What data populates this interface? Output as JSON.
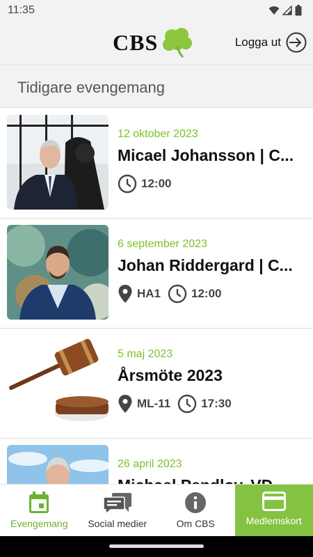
{
  "status_bar": {
    "time": "11:35"
  },
  "header": {
    "logo_text": "CBS",
    "logout_label": "Logga ut"
  },
  "section": {
    "title": "Tidigare evengemang"
  },
  "events": [
    {
      "date": "12 oktober 2023",
      "title": "Micael Johansson | C...",
      "location": "",
      "time": "12:00"
    },
    {
      "date": "6 september 2023",
      "title": "Johan Riddergard | C...",
      "location": "HA1",
      "time": "12:00"
    },
    {
      "date": "5 maj 2023",
      "title": "Årsmöte 2023",
      "location": "ML-11",
      "time": "17:30"
    },
    {
      "date": "26 april 2023",
      "title": "Michael Pendlov, VD",
      "location": "",
      "time": ""
    }
  ],
  "bottom_nav": [
    {
      "label": "Evengemang",
      "icon": "calendar-icon"
    },
    {
      "label": "Social medier",
      "icon": "chat-icon"
    },
    {
      "label": "Om CBS",
      "icon": "info-icon"
    },
    {
      "label": "Medlemskort",
      "icon": "card-icon"
    }
  ],
  "colors": {
    "accent": "#7cbf2b",
    "card_active": "#84c341"
  }
}
